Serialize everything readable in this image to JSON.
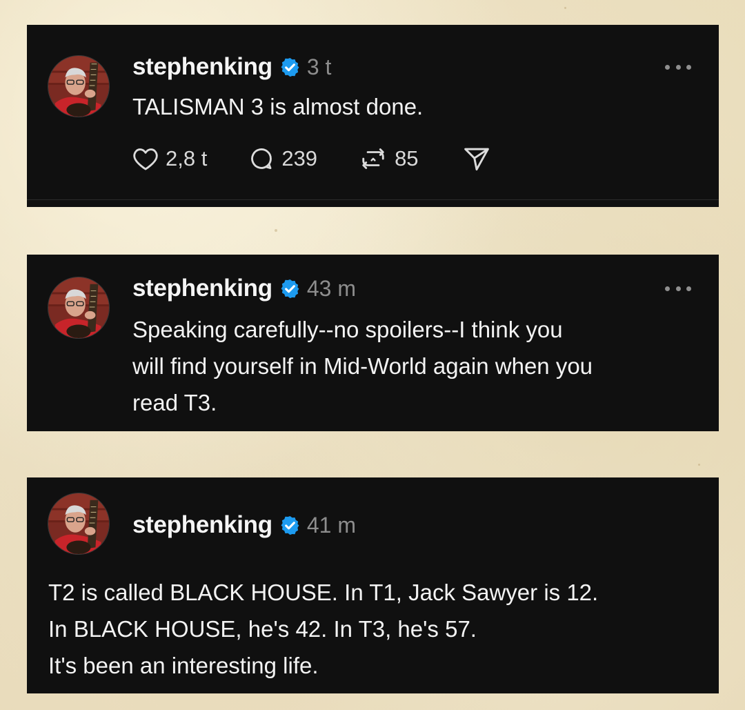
{
  "posts": [
    {
      "username": "stephenking",
      "time": "3 t",
      "lines": [
        "TALISMAN 3 is almost done."
      ],
      "likes": "2,8 t",
      "replies": "239",
      "reposts": "85"
    },
    {
      "username": "stephenking",
      "time": "43 m",
      "lines": [
        "Speaking carefully--no spoilers--I think you",
        "will find yourself in Mid-World again when you",
        "read T3."
      ]
    },
    {
      "username": "stephenking",
      "time": "41 m",
      "lines": [
        "T2 is called BLACK HOUSE. In T1, Jack Sawyer is 12.",
        "In BLACK HOUSE, he's 42. In T3, he's 57.",
        "It's been an interesting life."
      ]
    }
  ],
  "icons": {
    "verified": "verified-badge-icon",
    "more": "more-options-icon",
    "like": "heart-icon",
    "reply": "comment-icon",
    "repost": "repost-icon",
    "share": "send-icon"
  },
  "colors": {
    "card_bg": "#101010",
    "verified_blue": "#1d9bf0",
    "muted_text": "#8d8d8d",
    "background": "#efe6cc"
  }
}
